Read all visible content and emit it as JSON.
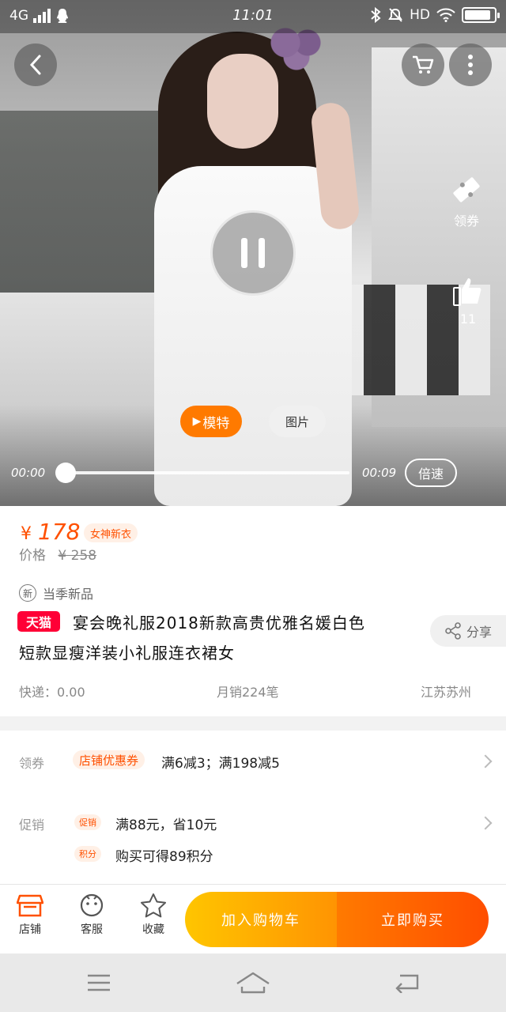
{
  "status_bar": {
    "network": "4G",
    "time": "11:01",
    "hd": "HD",
    "battery_level": 0.9
  },
  "video": {
    "time_current": "00:00",
    "time_total": "00:09",
    "progress": 0.0,
    "speed_label": "倍速",
    "model_label": "模特",
    "photo_label": "图片",
    "coupon_label": "领券",
    "like_count": "11"
  },
  "product": {
    "currency": "¥",
    "price": "178",
    "new_badge": "女神新衣",
    "orig_label": "价格",
    "orig_price": "¥ 258",
    "season_icon": "新",
    "season_label": "当季新品",
    "store_badge": "天猫",
    "title_line1": "宴会晚礼服2018新款高贵优雅名媛白色",
    "title_line2": "短款显瘦洋装小礼服连衣裙女",
    "share_label": "分享",
    "shipping": "快递：0.00",
    "monthly_sales": "月销224笔",
    "location": "江苏苏州"
  },
  "coupon_row": {
    "label": "领券",
    "tag": "店铺优惠券",
    "text": "满6减3；满198减5"
  },
  "promo_row": {
    "label": "促销",
    "tag1": "促销",
    "text1": "满88元，省10元",
    "tag2": "积分",
    "text2": "购买可得89积分"
  },
  "action_bar": {
    "store": "店铺",
    "service": "客服",
    "favorite": "收藏",
    "add_to_cart": "加入购物车",
    "buy_now": "立即购买"
  },
  "colors": {
    "accent": "#ff5000",
    "tmall_red": "#ff0036",
    "cart_yellow": "#ffc500",
    "buy_orange": "#ff4e00"
  }
}
